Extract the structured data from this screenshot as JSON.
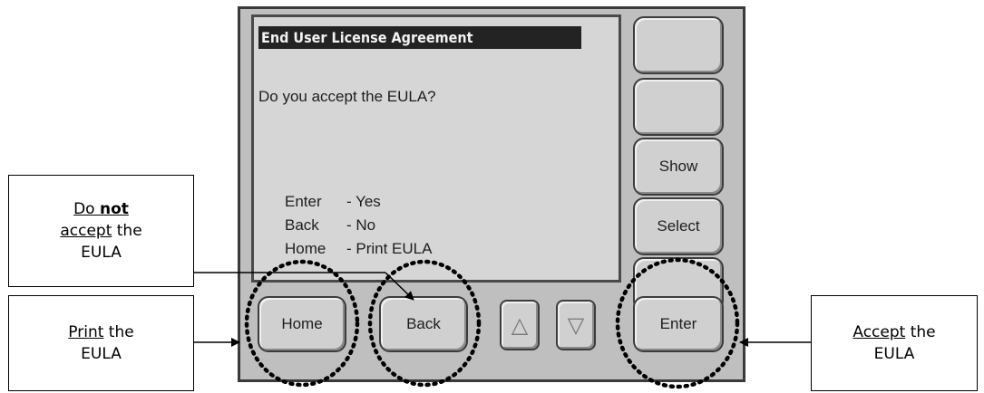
{
  "screen": {
    "title": "End User License Agreement",
    "question": "Do you accept the EULA?",
    "options": [
      {
        "key": "Enter",
        "action": "- Yes"
      },
      {
        "key": "Back",
        "action": "- No"
      },
      {
        "key": "Home",
        "action": "- Print EULA"
      }
    ]
  },
  "side_buttons": [
    "",
    "",
    "Show",
    "Select",
    ""
  ],
  "bottom_buttons": {
    "home": "Home",
    "back": "Back",
    "up": "△",
    "down": "▽",
    "enter": "Enter"
  },
  "callouts": {
    "print": {
      "line1_u": "Print",
      "line1_rest": " the",
      "line2": "EULA"
    },
    "not_accept": {
      "line1_u": "Do ",
      "line1_bold": "not",
      "line2_u": "accept",
      "line2_rest": " the",
      "line3": "EULA"
    },
    "accept": {
      "line1_u": "Accept",
      "line1_rest": " the",
      "line2": "EULA"
    }
  },
  "colors": {
    "device_body": "#bfbfbf",
    "screen": "#d6d6d6",
    "title_bar": "#232323",
    "highlight_ring": "#000000"
  }
}
